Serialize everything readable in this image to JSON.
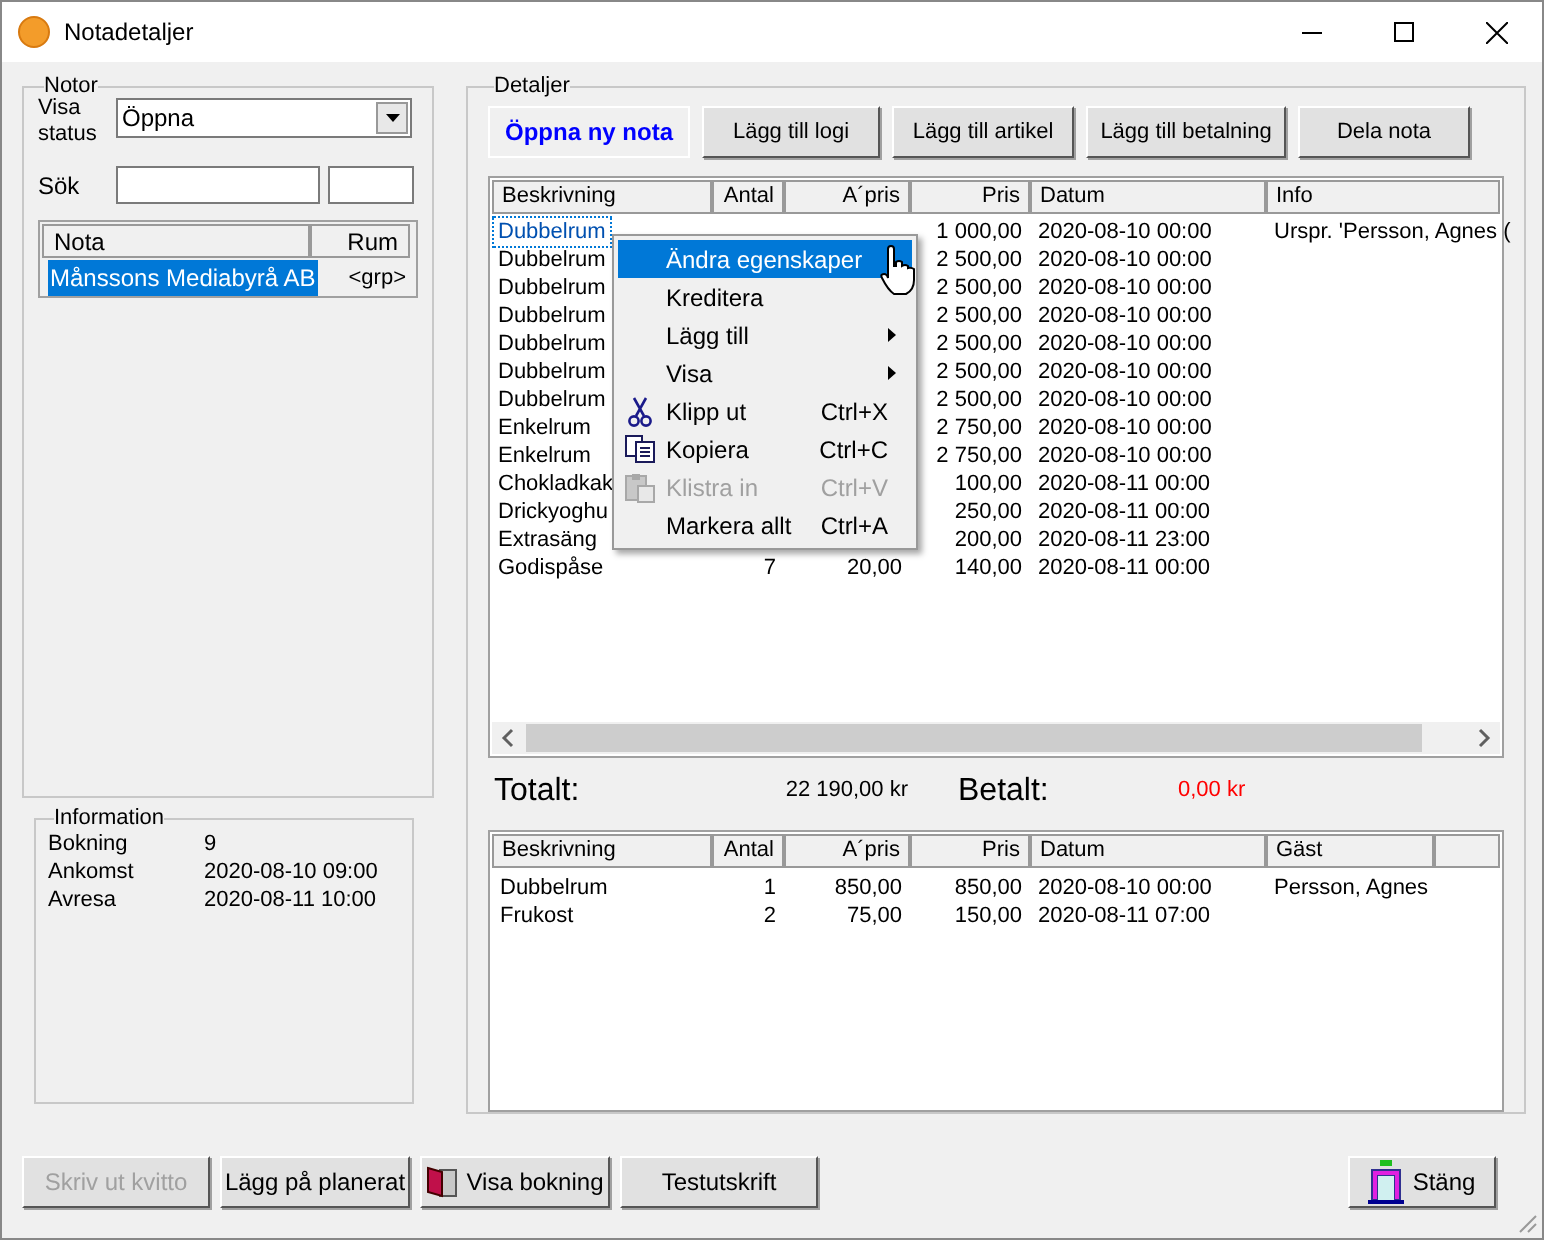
{
  "window": {
    "title": "Notadetaljer"
  },
  "notor": {
    "title": "Notor",
    "status_label": "Visa status",
    "status_value": "Öppna",
    "search_label": "Sök",
    "list": {
      "columns": [
        "Nota",
        "Rum"
      ],
      "rows": [
        {
          "nota": "Månssons Mediabyrå AB",
          "rum": "<grp>",
          "selected": true
        }
      ]
    }
  },
  "information": {
    "title": "Information",
    "rows": [
      {
        "label": "Bokning",
        "value": "9"
      },
      {
        "label": "Ankomst",
        "value": "2020-08-10 09:00"
      },
      {
        "label": "Avresa",
        "value": "2020-08-11 10:00"
      }
    ]
  },
  "details": {
    "title": "Detaljer",
    "buttons": [
      {
        "label": "Öppna ny nota",
        "kind": "primary"
      },
      {
        "label": "Lägg till logi",
        "kind": "normal"
      },
      {
        "label": "Lägg till artikel",
        "kind": "normal"
      },
      {
        "label": "Lägg till betalning",
        "kind": "normal"
      },
      {
        "label": "Dela nota",
        "kind": "normal"
      }
    ],
    "items_table": {
      "columns": [
        "Beskrivning",
        "Antal",
        "A´pris",
        "Pris",
        "Datum",
        "Info"
      ],
      "rows": [
        {
          "description": "Dubbelrum",
          "price": "1 000,00",
          "date": "2020-08-10 00:00",
          "info": "Urspr. 'Persson, Agnes (",
          "selected": true
        },
        {
          "description": "Dubbelrum",
          "price": "2 500,00",
          "date": "2020-08-10 00:00",
          "selected": false
        },
        {
          "description": "Dubbelrum",
          "price": "2 500,00",
          "date": "2020-08-10 00:00",
          "selected": false
        },
        {
          "description": "Dubbelrum",
          "price": "2 500,00",
          "date": "2020-08-10 00:00",
          "selected": false
        },
        {
          "description": "Dubbelrum",
          "price": "2 500,00",
          "date": "2020-08-10 00:00",
          "selected": false
        },
        {
          "description": "Dubbelrum",
          "price": "2 500,00",
          "date": "2020-08-10 00:00",
          "selected": false
        },
        {
          "description": "Dubbelrum",
          "price": "2 500,00",
          "date": "2020-08-10 00:00",
          "selected": false
        },
        {
          "description": "Enkelrum",
          "price": "2 750,00",
          "date": "2020-08-10 00:00",
          "selected": false
        },
        {
          "description": "Enkelrum",
          "price": "2 750,00",
          "date": "2020-08-10 00:00",
          "selected": false
        },
        {
          "description": "Chokladkak",
          "price": "100,00",
          "date": "2020-08-11 00:00",
          "selected": false
        },
        {
          "description": "Drickyoghu",
          "price": "250,00",
          "date": "2020-08-11 00:00",
          "selected": false
        },
        {
          "description": "Extrasäng",
          "price": "200,00",
          "date": "2020-08-11 23:00",
          "selected": false
        },
        {
          "description": "Godispåse",
          "quantity": "7",
          "unit_price": "20,00",
          "price": "140,00",
          "date": "2020-08-11 00:00",
          "selected": false
        }
      ]
    },
    "totals": {
      "total_label": "Totalt:",
      "total_value": "22 190,00 kr",
      "paid_label": "Betalt:",
      "paid_value": "0,00 kr"
    },
    "guest_table": {
      "columns": [
        "Beskrivning",
        "Antal",
        "A´pris",
        "Pris",
        "Datum",
        "Gäst"
      ],
      "rows": [
        {
          "description": "Dubbelrum",
          "quantity": "1",
          "unit_price": "850,00",
          "price": "850,00",
          "date": "2020-08-10 00:00",
          "guest": "Persson, Agnes"
        },
        {
          "description": "Frukost",
          "quantity": "2",
          "unit_price": "75,00",
          "price": "150,00",
          "date": "2020-08-11 07:00"
        }
      ]
    }
  },
  "context_menu": {
    "items": [
      {
        "label": "Ändra egenskaper",
        "kind": "plain",
        "submenu": false,
        "disabled": false,
        "selected": true
      },
      {
        "label": "Kreditera",
        "kind": "plain",
        "submenu": false,
        "disabled": false,
        "selected": false
      },
      {
        "label": "Lägg till",
        "kind": "plain",
        "submenu": true,
        "disabled": false,
        "selected": false
      },
      {
        "label": "Visa",
        "kind": "plain",
        "submenu": true,
        "disabled": false,
        "selected": false
      },
      {
        "label": "Klipp ut",
        "shortcut": "Ctrl+X",
        "kind": "cut",
        "submenu": false,
        "disabled": false,
        "selected": false
      },
      {
        "label": "Kopiera",
        "shortcut": "Ctrl+C",
        "kind": "copy",
        "submenu": false,
        "disabled": false,
        "selected": false
      },
      {
        "label": "Klistra in",
        "shortcut": "Ctrl+V",
        "kind": "paste",
        "submenu": false,
        "disabled": true,
        "selected": false
      },
      {
        "label": "Markera allt",
        "shortcut": "Ctrl+A",
        "kind": "plain",
        "submenu": false,
        "disabled": false,
        "selected": false
      }
    ]
  },
  "footer": {
    "buttons": [
      {
        "label": "Skriv ut kvitto",
        "kind": "plain",
        "disabled": true
      },
      {
        "label": "Lägg på planerat",
        "kind": "plain",
        "disabled": false
      },
      {
        "label": "Visa bokning",
        "kind": "book",
        "disabled": false
      },
      {
        "label": "Testutskrift",
        "kind": "plain",
        "disabled": false
      },
      {
        "label": "Stäng",
        "kind": "exit",
        "disabled": false
      }
    ]
  }
}
